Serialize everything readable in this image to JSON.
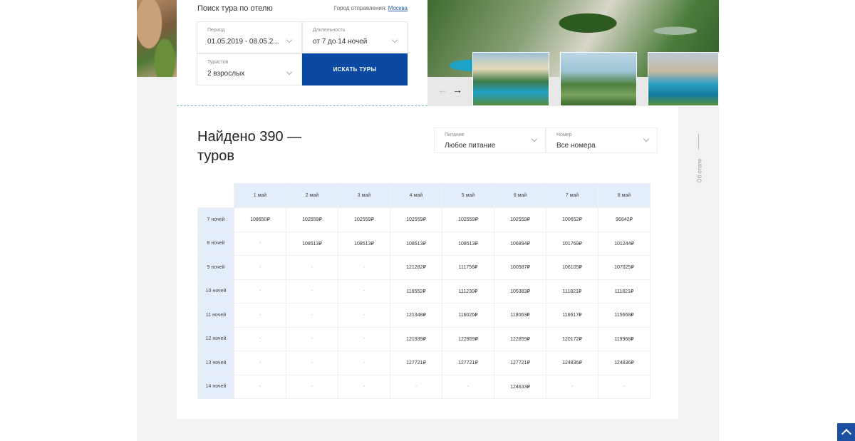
{
  "search": {
    "title": "Поиск тура по отелю",
    "departure_label": "Город отправления:",
    "departure_city": "Москва",
    "period": {
      "label": "Период",
      "value": "01.05.2019 - 08.05.2..."
    },
    "duration": {
      "label": "Длительность",
      "value": "от 7 до 14 ночей"
    },
    "tourists": {
      "label": "Туристов",
      "value": "2 взрослых"
    },
    "button": "ИСКАТЬ ТУРЫ"
  },
  "gallery": {
    "prev_icon": "arrow-left-icon",
    "next_icon": "arrow-right-icon"
  },
  "side": {
    "about_hotel": "Об отеле"
  },
  "results": {
    "found": "Найдено 390 — туров",
    "meal": {
      "label": "Питание",
      "value": "Любое питание"
    },
    "room": {
      "label": "Номер",
      "value": "Все номера"
    }
  },
  "price_table": {
    "columns": [
      "1 май",
      "2 май",
      "3 май",
      "4 май",
      "5 май",
      "6 май",
      "7 май",
      "8 май"
    ],
    "rows": [
      {
        "label": "7 ночей",
        "cells": [
          "108650₽",
          "102559₽",
          "102559₽",
          "102559₽",
          "102559₽",
          "102559₽",
          "100652₽",
          "96842₽"
        ]
      },
      {
        "label": "8 ночей",
        "cells": [
          "-",
          "108513₽",
          "108513₽",
          "108513₽",
          "108513₽",
          "106894₽",
          "101769₽",
          "101244₽"
        ]
      },
      {
        "label": "9 ночей",
        "cells": [
          "-",
          "-",
          "-",
          "121282₽",
          "111756₽",
          "100587₽",
          "106105₽",
          "107025₽"
        ]
      },
      {
        "label": "10 ночей",
        "cells": [
          "-",
          "-",
          "-",
          "116552₽",
          "111230₽",
          "105383₽",
          "111821₽",
          "111821₽"
        ]
      },
      {
        "label": "11 ночей",
        "cells": [
          "-",
          "-",
          "-",
          "121348₽",
          "116026₽",
          "118063₽",
          "116617₽",
          "115668₽"
        ]
      },
      {
        "label": "12 ночей",
        "cells": [
          "-",
          "-",
          "-",
          "121939₽",
          "122859₽",
          "122859₽",
          "120172₽",
          "119968₽"
        ]
      },
      {
        "label": "13 ночей",
        "cells": [
          "-",
          "-",
          "-",
          "127721₽",
          "127721₽",
          "127721₽",
          "124836₽",
          "124836₽"
        ]
      },
      {
        "label": "14 ночей",
        "cells": [
          "-",
          "-",
          "-",
          "-",
          "-",
          "124633₽",
          "-",
          "-"
        ]
      }
    ]
  },
  "ui": {
    "scroll_top_icon": "chevron-up-icon"
  }
}
